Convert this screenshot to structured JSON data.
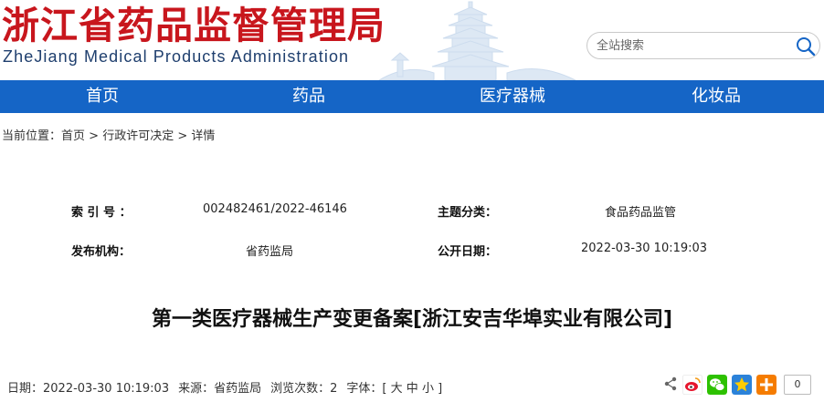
{
  "header": {
    "title": "浙江省药品监督管理局",
    "subtitle": "ZheJiang Medical Products Administration",
    "search_placeholder": "全站搜索"
  },
  "nav": {
    "items": [
      {
        "label": "首页"
      },
      {
        "label": "药品"
      },
      {
        "label": "医疗器械"
      },
      {
        "label": "化妆品"
      }
    ]
  },
  "breadcrumb": {
    "prefix": "当前位置：",
    "items": [
      "首页",
      "行政许可决定",
      "详情"
    ],
    "separator": ">"
  },
  "meta": {
    "index_label": "索 引 号 ：",
    "index_value": "002482461/2022-46146",
    "topic_label": "主题分类：",
    "topic_value": "食品药品监管",
    "publisher_label": "发布机构：",
    "publisher_value": "省药监局",
    "date_label": "公开日期：",
    "date_value": "2022-03-30 10:19:03"
  },
  "document": {
    "title": "第一类医疗器械生产变更备案[浙江安吉华埠实业有限公司]"
  },
  "info": {
    "date_label": "日期：",
    "date_value": "2022-03-30 10:19:03",
    "source_label": "来源：",
    "source_value": "省药监局",
    "views_label": "浏览次数：",
    "views_value": "2",
    "font_label": "字体：[",
    "font_large": "大",
    "font_medium": "中",
    "font_small": "小",
    "font_close": "]"
  },
  "share": {
    "count": "0",
    "icons": [
      "share-icon",
      "weibo-icon",
      "wechat-icon",
      "qzone-icon",
      "more-share-icon"
    ]
  },
  "colors": {
    "title_red": "#c8161d",
    "nav_blue": "#1565c6",
    "subtitle_blue": "#1f3f6e"
  }
}
